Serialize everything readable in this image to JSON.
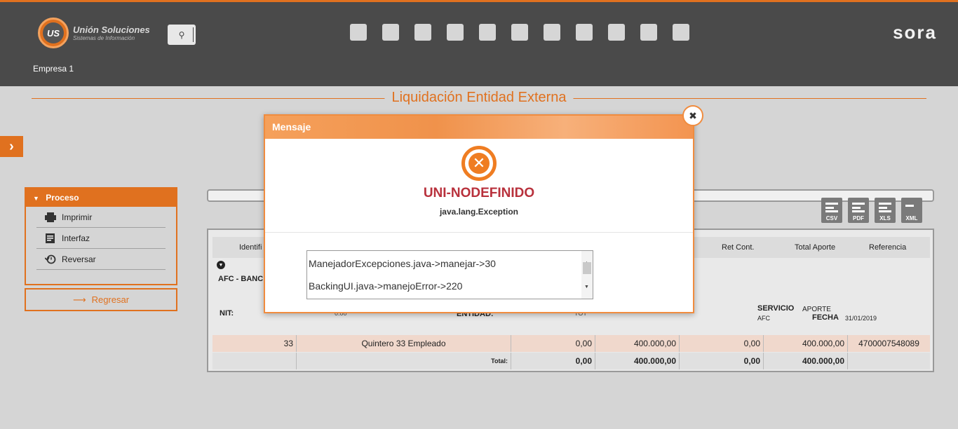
{
  "header": {
    "logo_line1": "Unión Soluciones",
    "logo_line2": "Sistemas de Información",
    "logo_mark": "US",
    "brand": "sora",
    "company": "Empresa 1",
    "nav_icons": [
      "document-edit-icon",
      "user-money-icon",
      "gift-icon",
      "org-chart-icon",
      "user-card-icon",
      "clock-refresh-icon",
      "list-document-icon",
      "presentation-icon",
      "gears-icon",
      "briefcase-shield-icon",
      "user-group-icon"
    ]
  },
  "page": {
    "title": "Liquidación Entidad Externa"
  },
  "proceso": {
    "title": "Proceso",
    "items": [
      "Imprimir",
      "Interfaz",
      "Reversar"
    ],
    "back_label": "Regresar"
  },
  "exports": [
    "CSV",
    "PDF",
    "XLS",
    "XML"
  ],
  "grid": {
    "headers": {
      "identificacion": "Identifi",
      "ret_cont": "Ret Cont.",
      "total_aporte": "Total Aporte",
      "referencia": "Referencia"
    },
    "group": "AFC - BANC",
    "nit_label": "NIT:",
    "nit_value": "0.00",
    "entidad_label": "ENTIDAD:",
    "entidad_value": "TOT",
    "servicio_label": "SERVICIO",
    "servicio_value": "APORTE",
    "servicio_sub": "AFC",
    "fecha_label": "FECHA",
    "fecha_value": "31/01/2019",
    "row": {
      "id": "33",
      "nombre": "Quintero 33 Empleado",
      "v1": "0,00",
      "v2": "400.000,00",
      "ret": "0,00",
      "total": "400.000,00",
      "ref": "4700007548089"
    },
    "total_row": {
      "label": "Total:",
      "v1": "0,00",
      "v2": "400.000,00",
      "ret": "0,00",
      "total": "400.000,00"
    }
  },
  "modal": {
    "title": "Mensaje",
    "error_code": "UNI-NODEFINIDO",
    "error_type": "java.lang.Exception",
    "trace_lines": [
      "ManejadorExcepciones.java->manejar->30",
      "BackingUI.java->manejoError->220"
    ],
    "close_symbol": "✖"
  }
}
